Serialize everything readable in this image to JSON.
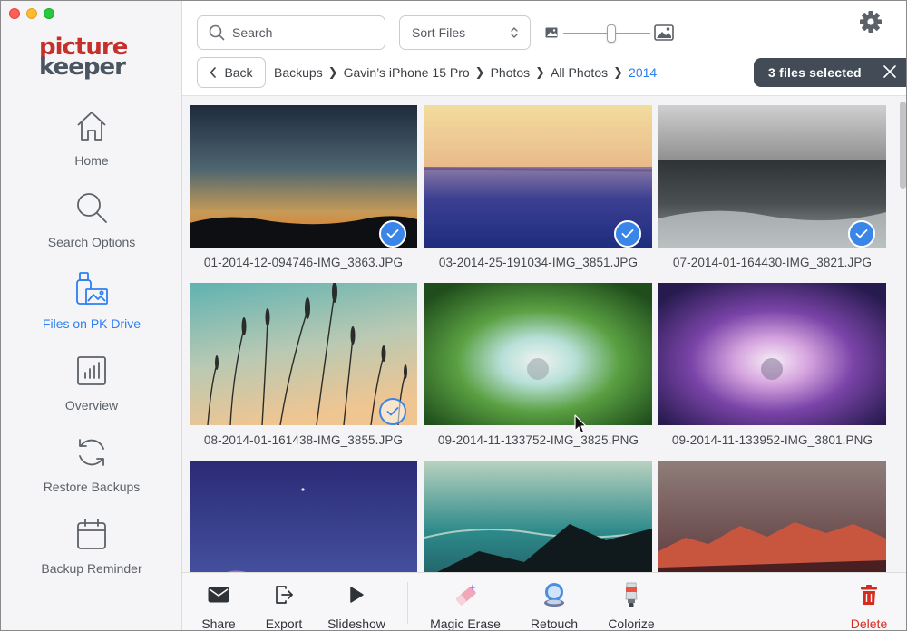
{
  "brand": {
    "line1": "picture",
    "line2": "keeper"
  },
  "sidebar": {
    "items": [
      {
        "label": "Home",
        "icon": "home-icon",
        "active": false
      },
      {
        "label": "Search Options",
        "icon": "search-icon",
        "active": false
      },
      {
        "label": "Files on PK Drive",
        "icon": "usb-drive-photo-icon",
        "active": true
      },
      {
        "label": "Overview",
        "icon": "bar-chart-icon",
        "active": false
      },
      {
        "label": "Restore Backups",
        "icon": "refresh-icon",
        "active": false
      },
      {
        "label": "Backup Reminder",
        "icon": "calendar-icon",
        "active": false
      }
    ]
  },
  "toolbar_top": {
    "search_placeholder": "Search",
    "sort_label": "Sort Files",
    "zoom_level": 0.5
  },
  "nav": {
    "back_label": "Back",
    "breadcrumb": [
      "Backups",
      "Gavin’s iPhone 15 Pro",
      "Photos",
      "All Photos",
      "2014"
    ]
  },
  "selection": {
    "label": "3 files selected"
  },
  "files": [
    {
      "name": "01-2014-12-094746-IMG_3863.JPG",
      "selected": true
    },
    {
      "name": "03-2014-25-191034-IMG_3851.JPG",
      "selected": true
    },
    {
      "name": "07-2014-01-164430-IMG_3821.JPG",
      "selected": true
    },
    {
      "name": "08-2014-01-161438-IMG_3855.JPG",
      "selected": false
    },
    {
      "name": "09-2014-11-133752-IMG_3825.PNG",
      "selected": false
    },
    {
      "name": "09-2014-11-133952-IMG_3801.PNG",
      "selected": false
    },
    {
      "name": "",
      "selected": false
    },
    {
      "name": "",
      "selected": false
    },
    {
      "name": "",
      "selected": false
    }
  ],
  "bottom_toolbar": [
    {
      "label": "Share",
      "icon": "envelope-icon"
    },
    {
      "label": "Export",
      "icon": "export-icon"
    },
    {
      "label": "Slideshow",
      "icon": "play-icon"
    },
    {
      "label": "Magic Erase",
      "icon": "eraser-icon"
    },
    {
      "label": "Retouch",
      "icon": "compact-mirror-icon"
    },
    {
      "label": "Colorize",
      "icon": "paint-tube-icon"
    },
    {
      "label": "Delete",
      "icon": "trash-icon"
    }
  ],
  "colors": {
    "accent": "#2d7ff0",
    "danger": "#d62c20",
    "brand_red": "#c6302b",
    "brand_gray": "#4a5560",
    "badge_bg": "#434c56"
  }
}
